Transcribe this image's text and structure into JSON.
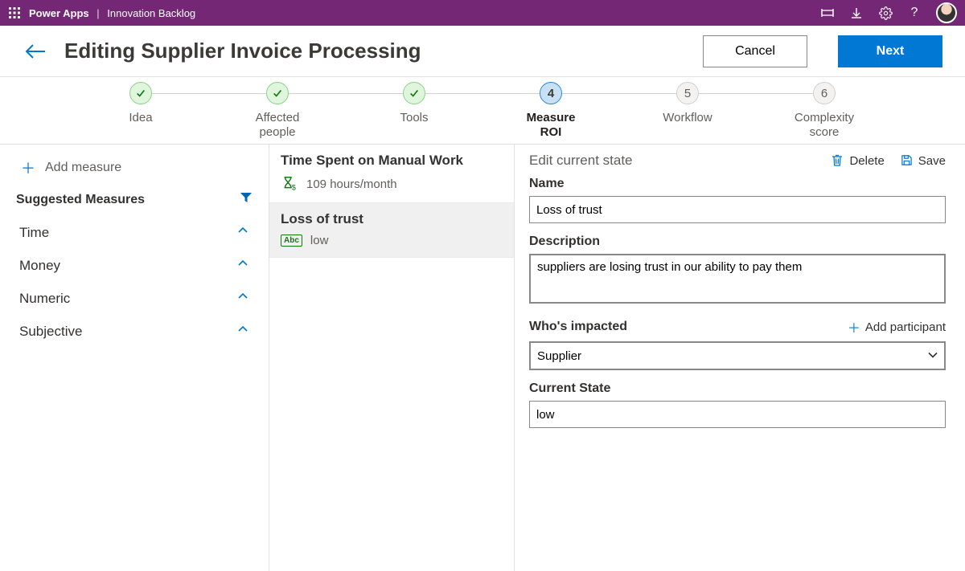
{
  "topbar": {
    "app": "Power Apps",
    "module": "Innovation Backlog"
  },
  "page": {
    "title": "Editing Supplier Invoice Processing",
    "cancel": "Cancel",
    "next": "Next"
  },
  "stepper": [
    {
      "label": "Idea",
      "state": "done"
    },
    {
      "label": "Affected people",
      "state": "done"
    },
    {
      "label": "Tools",
      "state": "done"
    },
    {
      "label": "Measure ROI",
      "state": "current",
      "num": "4"
    },
    {
      "label": "Workflow",
      "state": "pending",
      "num": "5"
    },
    {
      "label": "Complexity score",
      "state": "pending",
      "num": "6"
    }
  ],
  "sidebar": {
    "add_measure": "Add measure",
    "suggested_header": "Suggested Measures",
    "cats": [
      "Time",
      "Money",
      "Numeric",
      "Subjective"
    ]
  },
  "mid": {
    "items": [
      {
        "title": "Time Spent on Manual Work",
        "meta": "109 hours/month",
        "icon": "hourglass"
      },
      {
        "title": "Loss of trust",
        "meta": "low",
        "icon": "abc",
        "selected": true
      }
    ]
  },
  "detail": {
    "edit_title": "Edit current state",
    "delete": "Delete",
    "save": "Save",
    "name_label": "Name",
    "name_value": "Loss of trust",
    "desc_label": "Description",
    "desc_value": "suppliers are losing trust in our ability to pay them",
    "impacted_label": "Who's impacted",
    "add_participant": "Add participant",
    "impacted_value": "Supplier",
    "cs_label": "Current State",
    "cs_value": "low"
  }
}
